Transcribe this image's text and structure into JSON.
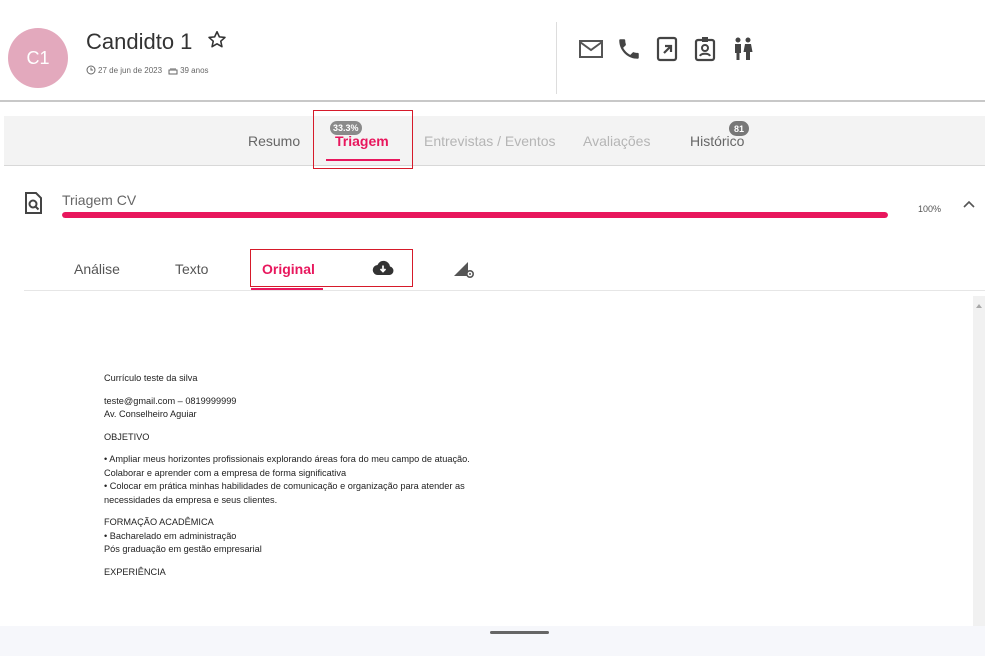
{
  "candidate": {
    "initials": "C1",
    "name": "Candidto 1",
    "date": "27 de jun de 2023",
    "age": "39 anos"
  },
  "tabs": [
    {
      "label": "Resumo"
    },
    {
      "label": "Triagem",
      "badge": "33.3%"
    },
    {
      "label": "Entrevistas / Eventos"
    },
    {
      "label": "Avaliações"
    },
    {
      "label": "Histórico",
      "badge": "81"
    }
  ],
  "section": {
    "title": "Triagem CV",
    "progress_label": "100%",
    "progress_value": 1.0
  },
  "subtabs": [
    {
      "label": "Análise"
    },
    {
      "label": "Texto"
    },
    {
      "label": "Original"
    }
  ],
  "document": {
    "lines": [
      "Currículo teste da silva",
      "",
      "teste@gmail.com – 0819999999",
      "Av. Conselheiro Aguiar",
      "",
      " OBJETIVO",
      "",
      " • Ampliar meus horizontes profissionais explorando áreas fora do meu campo de atuação.",
      "Colaborar e aprender com a empresa de forma significativa",
      "• Colocar em prática minhas habilidades de comunicação e organização para atender as",
      "necessidades da empresa e seus clientes.",
      "",
      "FORMAÇÃO ACADÊMICA",
      " • Bacharelado em administração",
      "Pós graduação em gestão empresarial",
      "",
      "EXPERIÊNCIA"
    ]
  },
  "colors": {
    "accent": "#e8175d",
    "avatar": "#e3a9bd",
    "highlight": "#d61a2a"
  }
}
